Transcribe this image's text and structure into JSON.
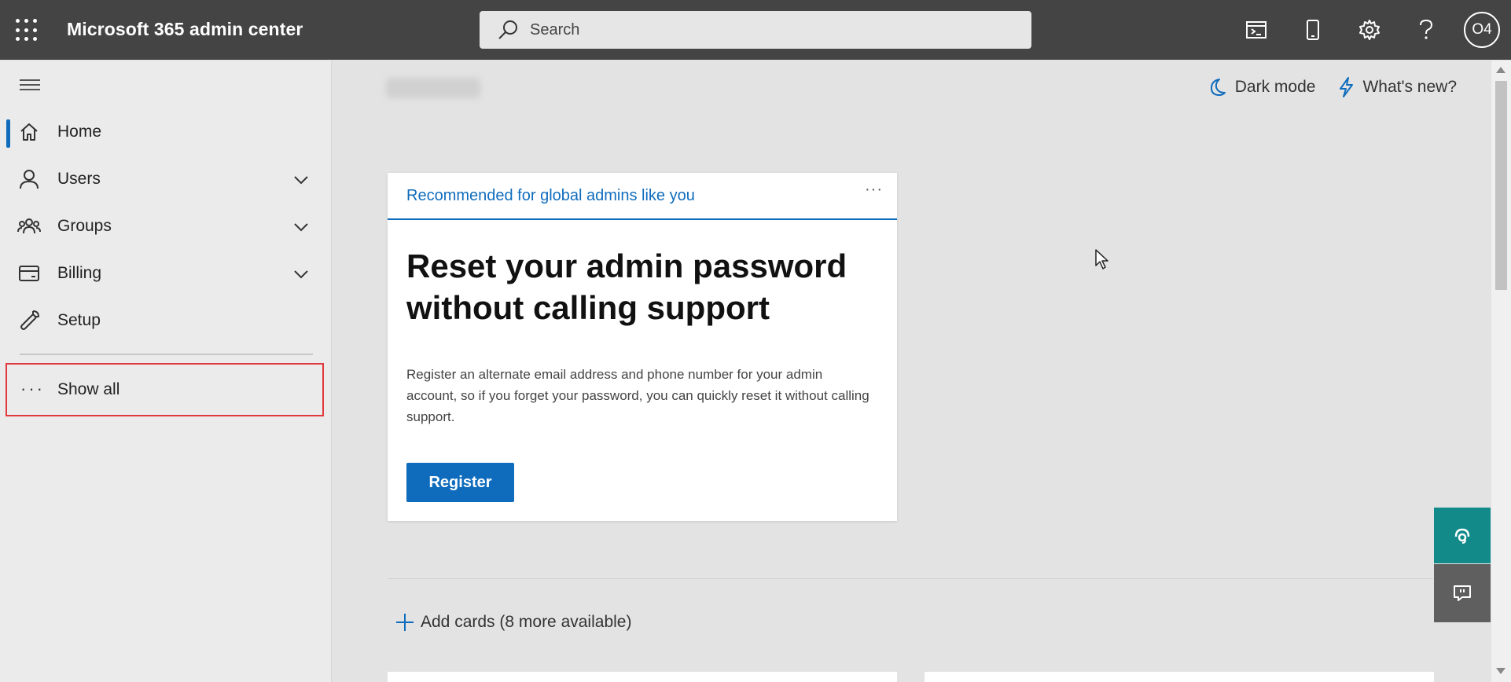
{
  "header": {
    "app_title": "Microsoft 365 admin center",
    "search_placeholder": "Search",
    "avatar_initials": "O4",
    "icons": [
      "waffle-icon",
      "cloud-shell-icon",
      "mobile-icon",
      "gear-icon",
      "help-icon"
    ]
  },
  "sidebar": {
    "items": [
      {
        "label": "Home",
        "icon": "home-icon",
        "active": true,
        "expandable": false
      },
      {
        "label": "Users",
        "icon": "user-icon",
        "active": false,
        "expandable": true
      },
      {
        "label": "Groups",
        "icon": "groups-icon",
        "active": false,
        "expandable": true
      },
      {
        "label": "Billing",
        "icon": "billing-icon",
        "active": false,
        "expandable": true
      },
      {
        "label": "Setup",
        "icon": "wrench-icon",
        "active": false,
        "expandable": false
      }
    ],
    "show_all_label": "Show all",
    "show_all_dots": "···"
  },
  "main": {
    "dark_mode_label": "Dark mode",
    "whats_new_label": "What's new?",
    "card": {
      "header": "Recommended for global admins like you",
      "more": "···",
      "headline": "Reset your admin password without calling support",
      "description": "Register an alternate email address and phone number for your admin account, so if you forget your password, you can quickly reset it without calling support.",
      "button_label": "Register"
    },
    "add_cards_label": "Add cards (8 more available)"
  },
  "colors": {
    "topbar": "#444444",
    "accent": "#0f6cbd",
    "highlight_border": "#e0393e",
    "support_fab": "#138a8a"
  }
}
